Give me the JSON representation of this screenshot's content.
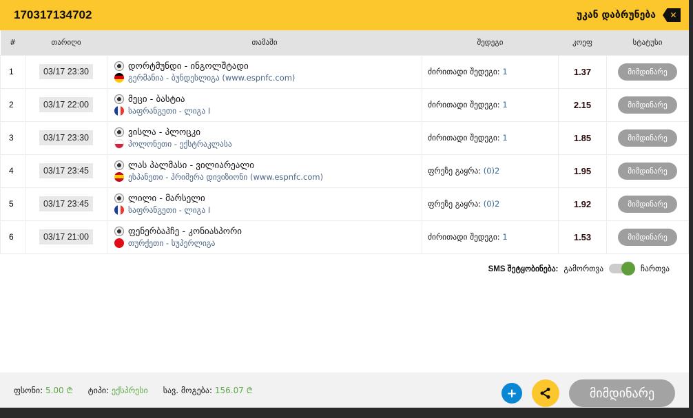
{
  "header": {
    "ticket_id": "170317134702",
    "back_label": "უკან დაბრუნება"
  },
  "columns": [
    "#",
    "თარიღი",
    "თამაში",
    "შედეგი",
    "კოეფ",
    "სტატუსი"
  ],
  "rows": [
    {
      "n": "1",
      "date": "03/17 23:30",
      "match": "დორტმუნდი - ინგოლშტადი",
      "country": "გერმანია",
      "league": " - ბუნდესლიგა (www.espnfc.com)",
      "bet_label": "ძირითადი შედეგი:",
      "bet_value": "1",
      "odds": "1.37",
      "status": "მიმდინარე",
      "flag": "de"
    },
    {
      "n": "2",
      "date": "03/17 22:00",
      "match": "მეცი - ბასტია",
      "country": "საფრანგეთი",
      "league": " - ლიგა I",
      "bet_label": "ძირითადი შედეგი:",
      "bet_value": "1",
      "odds": "2.15",
      "status": "მიმდინარე",
      "flag": "fr"
    },
    {
      "n": "3",
      "date": "03/17 23:30",
      "match": "ვისლა - პლოცკი",
      "country": "პოლონეთი",
      "league": " - ექსტრაკლასა",
      "bet_label": "ძირითადი შედეგი:",
      "bet_value": "1",
      "odds": "1.85",
      "status": "მიმდინარე",
      "flag": "pl"
    },
    {
      "n": "4",
      "date": "03/17 23:45",
      "match": "ლას პალმასი - ვილიარეალი",
      "country": "ესპანეთი",
      "league": " - პრიმერა დივიზიონი (www.espnfc.com)",
      "bet_label": "ფრეზე გაყრა:",
      "bet_value": "(0)2",
      "odds": "1.95",
      "status": "მიმდინარე",
      "flag": "es"
    },
    {
      "n": "5",
      "date": "03/17 23:45",
      "match": "ლილი - მარსელი",
      "country": "საფრანგეთი",
      "league": " - ლიგა I",
      "bet_label": "ფრეზე გაყრა:",
      "bet_value": "(0)2",
      "odds": "1.92",
      "status": "მიმდინარე",
      "flag": "fr"
    },
    {
      "n": "6",
      "date": "03/17 21:00",
      "match": "ფენერბაჰჩე - კონიასპორი",
      "country": "თურქეთი",
      "league": " - სუპერლიგა",
      "bet_label": "ძირითადი შედეგი:",
      "bet_value": "1",
      "odds": "1.53",
      "status": "მიმდინარე",
      "flag": "tr"
    }
  ],
  "sms": {
    "label": "SMS შეტყობინება:",
    "off": "გამორთვა",
    "on": "ჩართვა",
    "enabled": true
  },
  "footer": {
    "stake_label": "ფსონი:",
    "stake": "5.00 ₾",
    "type_label": "ტიპი:",
    "type": "ექსპრესი",
    "win_label": "სავ. მოგება:",
    "win": "156.07 ₾",
    "status_button": "მიმდინარე",
    "plus": "+"
  }
}
